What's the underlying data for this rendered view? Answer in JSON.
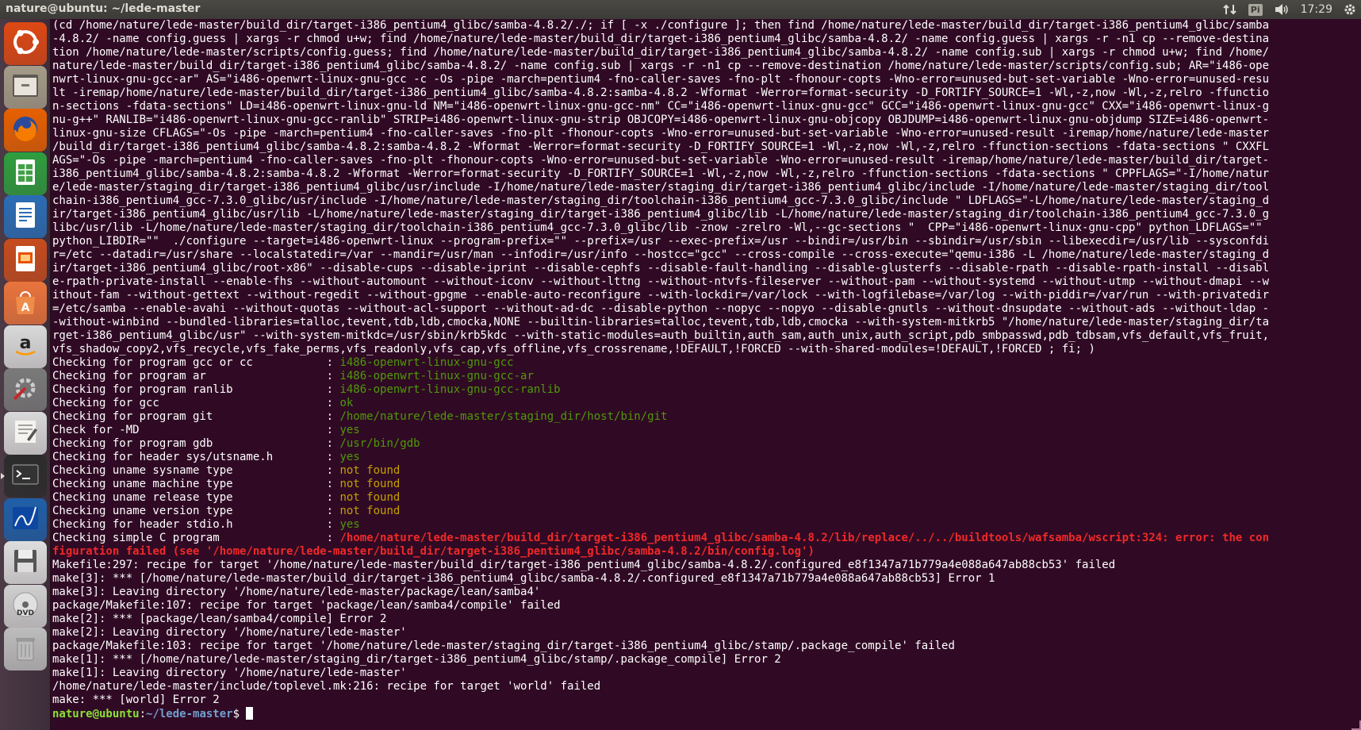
{
  "window": {
    "title": "nature@ubuntu: ~/lede-master"
  },
  "tray": {
    "keyboard_layout": "Pi",
    "clock": "17:29",
    "icons": [
      "network-arrows-icon",
      "keyboard-layout-icon",
      "volume-icon",
      "gear-icon"
    ]
  },
  "launcher": {
    "items": [
      {
        "name": "ubuntu-dash",
        "color": "#dd4814"
      },
      {
        "name": "files",
        "color": "#a49c88"
      },
      {
        "name": "firefox",
        "color": "#e66000"
      },
      {
        "name": "libreoffice-calc",
        "color": "#2e9e3e"
      },
      {
        "name": "libreoffice-writer",
        "color": "#2a6db5"
      },
      {
        "name": "libreoffice-impress",
        "color": "#c64c1e"
      },
      {
        "name": "ubuntu-software",
        "color": "#e9743c"
      },
      {
        "name": "amazon",
        "color": "#f0f0f0"
      },
      {
        "name": "system-settings",
        "color": "#7a7a7a"
      },
      {
        "name": "text-editor",
        "color": "#d7d3c8"
      },
      {
        "name": "terminal",
        "color": "#2c2c2c"
      },
      {
        "name": "system-monitor",
        "color": "#1f5fa8"
      },
      {
        "name": "save",
        "color": "#dedede"
      },
      {
        "name": "dvd",
        "color": "#cfcfcf"
      },
      {
        "name": "trash",
        "color": "#bdbdbd"
      }
    ]
  },
  "terminal": {
    "command_lines": [
      "(cd /home/nature/lede-master/build_dir/target-i386_pentium4_glibc/samba-4.8.2/./; if [ -x ./configure ]; then find /home/nature/lede-master/build_dir/target-i386_pentium4_glibc/samba",
      "-4.8.2/ -name config.guess | xargs -r chmod u+w; find /home/nature/lede-master/build_dir/target-i386_pentium4_glibc/samba-4.8.2/ -name config.guess | xargs -r -n1 cp --remove-destina",
      "tion /home/nature/lede-master/scripts/config.guess; find /home/nature/lede-master/build_dir/target-i386_pentium4_glibc/samba-4.8.2/ -name config.sub | xargs -r chmod u+w; find /home/",
      "nature/lede-master/build_dir/target-i386_pentium4_glibc/samba-4.8.2/ -name config.sub | xargs -r -n1 cp --remove-destination /home/nature/lede-master/scripts/config.sub; AR=\"i486-ope",
      "nwrt-linux-gnu-gcc-ar\" AS=\"i486-openwrt-linux-gnu-gcc -c -Os -pipe -march=pentium4 -fno-caller-saves -fno-plt -fhonour-copts -Wno-error=unused-but-set-variable -Wno-error=unused-resu",
      "lt -iremap/home/nature/lede-master/build_dir/target-i386_pentium4_glibc/samba-4.8.2:samba-4.8.2 -Wformat -Werror=format-security -D_FORTIFY_SOURCE=1 -Wl,-z,now -Wl,-z,relro -ffunctio",
      "n-sections -fdata-sections\" LD=i486-openwrt-linux-gnu-ld NM=\"i486-openwrt-linux-gnu-gcc-nm\" CC=\"i486-openwrt-linux-gnu-gcc\" GCC=\"i486-openwrt-linux-gnu-gcc\" CXX=\"i486-openwrt-linux-g",
      "nu-g++\" RANLIB=\"i486-openwrt-linux-gnu-gcc-ranlib\" STRIP=i486-openwrt-linux-gnu-strip OBJCOPY=i486-openwrt-linux-gnu-objcopy OBJDUMP=i486-openwrt-linux-gnu-objdump SIZE=i486-openwrt-",
      "linux-gnu-size CFLAGS=\"-Os -pipe -march=pentium4 -fno-caller-saves -fno-plt -fhonour-copts -Wno-error=unused-but-set-variable -Wno-error=unused-result -iremap/home/nature/lede-master",
      "/build_dir/target-i386_pentium4_glibc/samba-4.8.2:samba-4.8.2 -Wformat -Werror=format-security -D_FORTIFY_SOURCE=1 -Wl,-z,now -Wl,-z,relro -ffunction-sections -fdata-sections \" CXXFL",
      "AGS=\"-Os -pipe -march=pentium4 -fno-caller-saves -fno-plt -fhonour-copts -Wno-error=unused-but-set-variable -Wno-error=unused-result -iremap/home/nature/lede-master/build_dir/target-",
      "i386_pentium4_glibc/samba-4.8.2:samba-4.8.2 -Wformat -Werror=format-security -D_FORTIFY_SOURCE=1 -Wl,-z,now -Wl,-z,relro -ffunction-sections -fdata-sections \" CPPFLAGS=\"-I/home/natur",
      "e/lede-master/staging_dir/target-i386_pentium4_glibc/usr/include -I/home/nature/lede-master/staging_dir/target-i386_pentium4_glibc/include -I/home/nature/lede-master/staging_dir/tool",
      "chain-i386_pentium4_gcc-7.3.0_glibc/usr/include -I/home/nature/lede-master/staging_dir/toolchain-i386_pentium4_gcc-7.3.0_glibc/include \" LDFLAGS=\"-L/home/nature/lede-master/staging_d",
      "ir/target-i386_pentium4_glibc/usr/lib -L/home/nature/lede-master/staging_dir/target-i386_pentium4_glibc/lib -L/home/nature/lede-master/staging_dir/toolchain-i386_pentium4_gcc-7.3.0_g",
      "libc/usr/lib -L/home/nature/lede-master/staging_dir/toolchain-i386_pentium4_gcc-7.3.0_glibc/lib -znow -zrelro -Wl,--gc-sections \"  CPP=\"i486-openwrt-linux-gnu-cpp\" python_LDFLAGS=\"\"",
      "python_LIBDIR=\"\"  ./configure --target=i486-openwrt-linux --program-prefix=\"\" --prefix=/usr --exec-prefix=/usr --bindir=/usr/bin --sbindir=/usr/sbin --libexecdir=/usr/lib --sysconfdi",
      "r=/etc --datadir=/usr/share --localstatedir=/var --mandir=/usr/man --infodir=/usr/info --hostcc=\"gcc\" --cross-compile --cross-execute=\"qemu-i386 -L /home/nature/lede-master/staging_d",
      "ir/target-i386_pentium4_glibc/root-x86\" --disable-cups --disable-iprint --disable-cephfs --disable-fault-handling --disable-glusterfs --disable-rpath --disable-rpath-install --disabl",
      "e-rpath-private-install --enable-fhs --without-automount --without-iconv --without-lttng --without-ntvfs-fileserver --without-pam --without-systemd --without-utmp --without-dmapi --w",
      "ithout-fam --without-gettext --without-regedit --without-gpgme --enable-auto-reconfigure --with-lockdir=/var/lock --with-logfilebase=/var/log --with-piddir=/var/run --with-privatedir",
      "=/etc/samba --enable-avahi --without-quotas --without-acl-support --without-ad-dc --disable-python --nopyc --nopyo --disable-gnutls --without-dnsupdate --without-ads --without-ldap -",
      "-without-winbind --bundled-libraries=talloc,tevent,tdb,ldb,cmocka,NONE --builtin-libraries=talloc,tevent,tdb,ldb,cmocka --with-system-mitkrb5 \"/home/nature/lede-master/staging_dir/ta",
      "rget-i386_pentium4_glibc/usr\" --with-system-mitkdc=/usr/sbin/krb5kdc --with-static-modules=auth_builtin,auth_sam,auth_unix,auth_script,pdb_smbpasswd,pdb_tdbsam,vfs_default,vfs_fruit,",
      "vfs_shadow_copy2,vfs_recycle,vfs_fake_perms,vfs_readonly,vfs_cap,vfs_offline,vfs_crossrename,!DEFAULT,!FORCED --with-shared-modules=!DEFAULT,!FORCED ; fi; )"
    ],
    "checks": [
      {
        "label": "Checking for program gcc or cc           ",
        "result": "i486-openwrt-linux-gnu-gcc",
        "status": "ok"
      },
      {
        "label": "Checking for program ar                  ",
        "result": "i486-openwrt-linux-gnu-gcc-ar",
        "status": "ok"
      },
      {
        "label": "Checking for program ranlib              ",
        "result": "i486-openwrt-linux-gnu-gcc-ranlib",
        "status": "ok"
      },
      {
        "label": "Checking for gcc                         ",
        "result": "ok",
        "status": "ok"
      },
      {
        "label": "Checking for program git                 ",
        "result": "/home/nature/lede-master/staging_dir/host/bin/git",
        "status": "ok"
      },
      {
        "label": "Check for -MD                            ",
        "result": "yes",
        "status": "ok"
      },
      {
        "label": "Checking for program gdb                 ",
        "result": "/usr/bin/gdb",
        "status": "ok"
      },
      {
        "label": "Checking for header sys/utsname.h        ",
        "result": "yes",
        "status": "ok"
      },
      {
        "label": "Checking uname sysname type              ",
        "result": "not found",
        "status": "warn"
      },
      {
        "label": "Checking uname machine type              ",
        "result": "not found",
        "status": "warn"
      },
      {
        "label": "Checking uname release type              ",
        "result": "not found",
        "status": "warn"
      },
      {
        "label": "Checking uname version type              ",
        "result": "not found",
        "status": "warn"
      },
      {
        "label": "Checking for header stdio.h              ",
        "result": "yes",
        "status": "ok"
      },
      {
        "label": "Checking simple C program                ",
        "result": "/home/nature/lede-master/build_dir/target-i386_pentium4_glibc/samba-4.8.2/lib/replace/../../buildtools/wafsamba/wscript:324: error: the con",
        "status": "err"
      }
    ],
    "error_continuation": "figuration failed (see '/home/nature/lede-master/build_dir/target-i386_pentium4_glibc/samba-4.8.2/bin/config.log')",
    "make_lines": [
      "Makefile:297: recipe for target '/home/nature/lede-master/build_dir/target-i386_pentium4_glibc/samba-4.8.2/.configured_e8f1347a71b779a4e088a647ab88cb53' failed",
      "make[3]: *** [/home/nature/lede-master/build_dir/target-i386_pentium4_glibc/samba-4.8.2/.configured_e8f1347a71b779a4e088a647ab88cb53] Error 1",
      "make[3]: Leaving directory '/home/nature/lede-master/package/lean/samba4'",
      "package/Makefile:107: recipe for target 'package/lean/samba4/compile' failed",
      "make[2]: *** [package/lean/samba4/compile] Error 2",
      "make[2]: Leaving directory '/home/nature/lede-master'",
      "package/Makefile:103: recipe for target '/home/nature/lede-master/staging_dir/target-i386_pentium4_glibc/stamp/.package_compile' failed",
      "make[1]: *** [/home/nature/lede-master/staging_dir/target-i386_pentium4_glibc/stamp/.package_compile] Error 2",
      "make[1]: Leaving directory '/home/nature/lede-master'",
      "/home/nature/lede-master/include/toplevel.mk:216: recipe for target 'world' failed",
      "make: *** [world] Error 2"
    ],
    "prompt": {
      "user_host": "nature@ubuntu",
      "separator": ":",
      "path": "~/lede-master",
      "symbol": "$ "
    }
  }
}
